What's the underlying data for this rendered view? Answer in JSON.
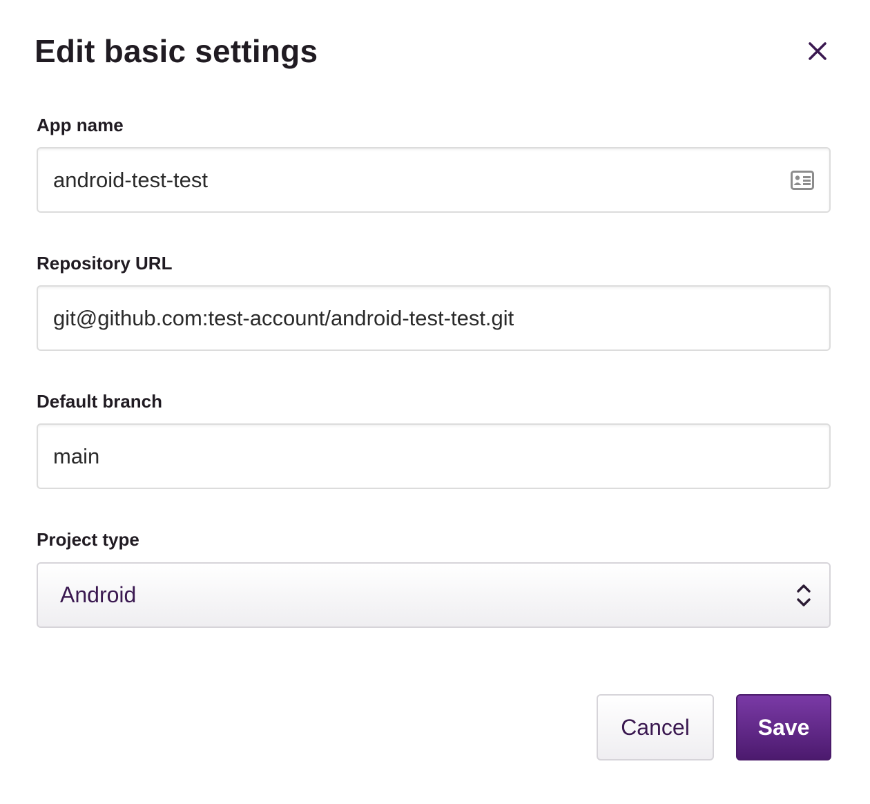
{
  "dialog": {
    "title": "Edit basic settings",
    "close_icon": "close-icon"
  },
  "fields": {
    "app_name": {
      "label": "App name",
      "value": "android-test-test",
      "icon": "contact-card-icon"
    },
    "repository_url": {
      "label": "Repository URL",
      "value": "git@github.com:test-account/android-test-test.git"
    },
    "default_branch": {
      "label": "Default branch",
      "value": "main"
    },
    "project_type": {
      "label": "Project type",
      "selected": "Android",
      "icon": "chevron-up-down-icon"
    }
  },
  "actions": {
    "cancel_label": "Cancel",
    "save_label": "Save"
  },
  "colors": {
    "accent": "#5c2383",
    "select_text": "#3a1850",
    "close_icon": "#3a1850",
    "input_icon": "#8c8c8c"
  }
}
